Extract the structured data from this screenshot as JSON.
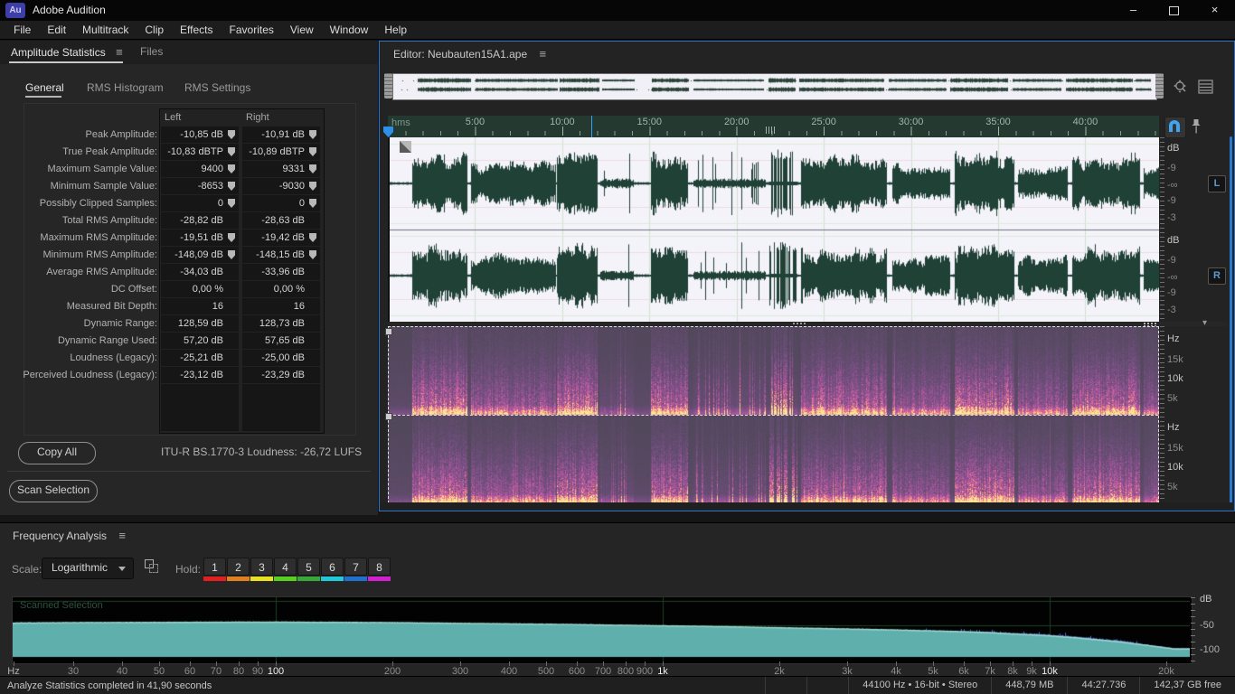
{
  "app": {
    "title": "Adobe Audition",
    "logo": "Au"
  },
  "window_controls": {
    "minimize": "–",
    "close": "×"
  },
  "icons": {
    "menu": "≡",
    "caret": "▾"
  },
  "menu": {
    "items": [
      "File",
      "Edit",
      "Multitrack",
      "Clip",
      "Effects",
      "Favorites",
      "View",
      "Window",
      "Help"
    ]
  },
  "stats_panel": {
    "tab_active": "Amplitude Statistics",
    "tab_inactive": "Files",
    "subtabs": [
      "General",
      "RMS Histogram",
      "RMS Settings"
    ],
    "active_subtab": "General",
    "col_left": "Left",
    "col_right": "Right",
    "rows": [
      {
        "label": "Peak Amplitude:",
        "left": "-10,85 dB",
        "right": "-10,91 dB",
        "pin": true
      },
      {
        "label": "True Peak Amplitude:",
        "left": "-10,83 dBTP",
        "right": "-10,89 dBTP",
        "pin": true
      },
      {
        "label": "Maximum Sample Value:",
        "left": "9400",
        "right": "9331",
        "pin": true
      },
      {
        "label": "Minimum Sample Value:",
        "left": "-8653",
        "right": "-9030",
        "pin": true
      },
      {
        "label": "Possibly Clipped Samples:",
        "left": "0",
        "right": "0",
        "pin": true
      },
      {
        "label": "Total RMS Amplitude:",
        "left": "-28,82 dB",
        "right": "-28,63 dB",
        "pin": false
      },
      {
        "label": "Maximum RMS Amplitude:",
        "left": "-19,51 dB",
        "right": "-19,42 dB",
        "pin": true
      },
      {
        "label": "Minimum RMS Amplitude:",
        "left": "-148,09 dB",
        "right": "-148,15 dB",
        "pin": true
      },
      {
        "label": "Average RMS Amplitude:",
        "left": "-34,03 dB",
        "right": "-33,96 dB",
        "pin": false
      },
      {
        "label": "DC Offset:",
        "left": "0,00 %",
        "right": "0,00 %",
        "pin": false
      },
      {
        "label": "Measured Bit Depth:",
        "left": "16",
        "right": "16",
        "pin": false
      },
      {
        "label": "Dynamic Range:",
        "left": "128,59 dB",
        "right": "128,73 dB",
        "pin": false
      },
      {
        "label": "Dynamic Range Used:",
        "left": "57,20 dB",
        "right": "57,65 dB",
        "pin": false
      },
      {
        "label": "Loudness (Legacy):",
        "left": "-25,21 dB",
        "right": "-25,00 dB",
        "pin": false
      },
      {
        "label": "Perceived Loudness (Legacy):",
        "left": "-23,12 dB",
        "right": "-23,29 dB",
        "pin": false
      }
    ],
    "copy_all_label": "Copy All",
    "itu_loudness": "ITU-R BS.1770-3 Loudness:  -26,72 LUFS",
    "scan_selection_label": "Scan Selection"
  },
  "editor": {
    "title": "Editor: Neubauten15A1.ape",
    "ruler_unit": "hms",
    "ruler_labels": [
      "5:00",
      "10:00",
      "15:00",
      "20:00",
      "25:00",
      "30:00",
      "35:00",
      "40:00"
    ],
    "db_scale": [
      "dB",
      "-9",
      "-∞",
      "-9",
      "-3"
    ],
    "channel_badges": [
      "L",
      "R"
    ],
    "freq_scale": [
      "Hz",
      "15k",
      "10k",
      "5k"
    ],
    "duration_sec": 2667.736,
    "view_end_sec": 2655,
    "playhead_sec": 0,
    "ruler_mark_sec": 700,
    "segments": [
      [
        84,
        271,
        0.8
      ],
      [
        286,
        576,
        0.55
      ],
      [
        582,
        722,
        0.8
      ],
      [
        730,
        845,
        0.3
      ],
      [
        903,
        1033,
        0.75
      ],
      [
        1049,
        1298,
        0.32
      ],
      [
        1313,
        1407,
        0.85,
        1
      ],
      [
        1422,
        1718,
        0.7
      ],
      [
        1734,
        1936,
        0.5
      ],
      [
        1951,
        2154,
        0.8
      ],
      [
        2169,
        2340,
        0.5
      ],
      [
        2356,
        2589,
        0.75
      ],
      [
        2600,
        2655,
        0.4
      ]
    ]
  },
  "frequency_panel": {
    "title": "Frequency Analysis",
    "scale_label": "Scale:",
    "scale_value": "Logarithmic",
    "hold_label": "Hold:",
    "hold_buttons": [
      {
        "label": "1",
        "color": "#e02020"
      },
      {
        "label": "2",
        "color": "#e08020"
      },
      {
        "label": "3",
        "color": "#e8e020"
      },
      {
        "label": "4",
        "color": "#58d020"
      },
      {
        "label": "5",
        "color": "#38a838"
      },
      {
        "label": "6",
        "color": "#20c8d8"
      },
      {
        "label": "7",
        "color": "#2070d0"
      },
      {
        "label": "8",
        "color": "#d020d0"
      }
    ],
    "plot_label": "Scanned Selection",
    "y_ticks": [
      "dB",
      "-50",
      "-100"
    ],
    "x_ticks": [
      {
        "label": "Hz",
        "f": 21,
        "unit": true
      },
      {
        "label": "30",
        "f": 30
      },
      {
        "label": "40",
        "f": 40
      },
      {
        "label": "50",
        "f": 50
      },
      {
        "label": "60",
        "f": 60
      },
      {
        "label": "70",
        "f": 70
      },
      {
        "label": "80",
        "f": 80
      },
      {
        "label": "90",
        "f": 90
      },
      {
        "label": "100",
        "f": 100,
        "strong": true
      },
      {
        "label": "200",
        "f": 200
      },
      {
        "label": "300",
        "f": 300
      },
      {
        "label": "400",
        "f": 400
      },
      {
        "label": "500",
        "f": 500
      },
      {
        "label": "600",
        "f": 600
      },
      {
        "label": "700",
        "f": 700
      },
      {
        "label": "800",
        "f": 800
      },
      {
        "label": "900",
        "f": 900
      },
      {
        "label": "1k",
        "f": 1000,
        "strong": true
      },
      {
        "label": "2k",
        "f": 2000
      },
      {
        "label": "3k",
        "f": 3000
      },
      {
        "label": "4k",
        "f": 4000
      },
      {
        "label": "5k",
        "f": 5000
      },
      {
        "label": "6k",
        "f": 6000
      },
      {
        "label": "7k",
        "f": 7000
      },
      {
        "label": "8k",
        "f": 8000
      },
      {
        "label": "9k",
        "f": 9000
      },
      {
        "label": "10k",
        "f": 10000,
        "strong": true
      },
      {
        "label": "20k",
        "f": 20000
      }
    ]
  },
  "chart_data": {
    "type": "area",
    "title": "Frequency Analysis (Scanned Selection)",
    "xlabel": "Hz",
    "ylabel": "dB",
    "x_scale": "log",
    "xlim": [
      20,
      23000
    ],
    "ylim": [
      -110,
      0
    ],
    "grid": true,
    "legend_position": "none",
    "series": [
      {
        "name": "Left",
        "color": "#5fb0ac",
        "points": [
          [
            20,
            -46
          ],
          [
            30,
            -45
          ],
          [
            50,
            -44.5
          ],
          [
            80,
            -44
          ],
          [
            100,
            -44
          ],
          [
            150,
            -44.5
          ],
          [
            200,
            -45
          ],
          [
            300,
            -46.5
          ],
          [
            400,
            -47.5
          ],
          [
            600,
            -49
          ],
          [
            800,
            -50.5
          ],
          [
            1000,
            -51.5
          ],
          [
            1500,
            -53.5
          ],
          [
            2000,
            -55.5
          ],
          [
            3000,
            -58
          ],
          [
            4000,
            -60
          ],
          [
            5000,
            -62
          ],
          [
            6000,
            -63.5
          ],
          [
            7000,
            -65.5
          ],
          [
            8000,
            -68
          ],
          [
            9000,
            -70
          ],
          [
            10000,
            -72
          ],
          [
            12000,
            -77
          ],
          [
            15000,
            -84
          ],
          [
            18000,
            -92
          ],
          [
            21000,
            -99
          ]
        ]
      },
      {
        "name": "Right",
        "color": "#5272c8",
        "points": [
          [
            20,
            -46.5
          ],
          [
            100,
            -44.5
          ],
          [
            1000,
            -52
          ],
          [
            3000,
            -58
          ],
          [
            5000,
            -61.5
          ],
          [
            7000,
            -64
          ],
          [
            9000,
            -67.5
          ],
          [
            10000,
            -69
          ],
          [
            12000,
            -74
          ],
          [
            15000,
            -81
          ],
          [
            18000,
            -90
          ],
          [
            21000,
            -97
          ]
        ]
      }
    ]
  },
  "statusbar": {
    "message": "Analyze Statistics completed in 41,90 seconds",
    "cells": [
      "44100 Hz • 16-bit • Stereo",
      "448,79 MB",
      "44:27.736",
      "142,37 GB free"
    ]
  }
}
